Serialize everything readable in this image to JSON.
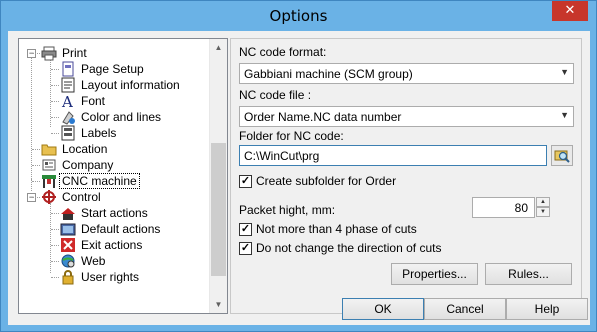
{
  "window": {
    "title": "Options",
    "close_glyph": "✕"
  },
  "tree": {
    "items": [
      {
        "label": "Print",
        "icon": "printer-icon",
        "level": 0
      },
      {
        "label": "Page Setup",
        "icon": "page-setup-icon",
        "level": 1
      },
      {
        "label": "Layout information",
        "icon": "layout-icon",
        "level": 1
      },
      {
        "label": "Font",
        "icon": "font-icon",
        "level": 1
      },
      {
        "label": "Color and lines",
        "icon": "color-icon",
        "level": 1
      },
      {
        "label": "Labels",
        "icon": "labels-icon",
        "level": 1
      },
      {
        "label": "Location",
        "icon": "folder-icon",
        "level": 0
      },
      {
        "label": "Company",
        "icon": "company-icon",
        "level": 0
      },
      {
        "label": "CNC machine",
        "icon": "cnc-icon",
        "level": 0
      },
      {
        "label": "Control",
        "icon": "control-icon",
        "level": 0
      },
      {
        "label": "Start actions",
        "icon": "start-icon",
        "level": 1
      },
      {
        "label": "Default actions",
        "icon": "default-icon",
        "level": 1
      },
      {
        "label": "Exit actions",
        "icon": "exit-icon",
        "level": 1
      },
      {
        "label": "Web",
        "icon": "web-icon",
        "level": 1
      },
      {
        "label": "User rights",
        "icon": "lock-icon",
        "level": 1
      }
    ]
  },
  "panel": {
    "nc_format_label": "NC code format:",
    "nc_format_value": "Gabbiani machine (SCM group)",
    "nc_file_label": "NC code file :",
    "nc_file_value": "Order Name.NC data number",
    "folder_label": "Folder for NC code:",
    "folder_value": "C:\\WinCut\\prg",
    "create_subfolder": "Create subfolder for Order",
    "packet_label": "Packet hight, mm:",
    "packet_value": "80",
    "not_more": "Not more than 4 phase of cuts",
    "no_change_dir": "Do not change the direction of cuts",
    "properties": "Properties...",
    "rules": "Rules..."
  },
  "footer": {
    "ok": "OK",
    "cancel": "Cancel",
    "help": "Help"
  }
}
